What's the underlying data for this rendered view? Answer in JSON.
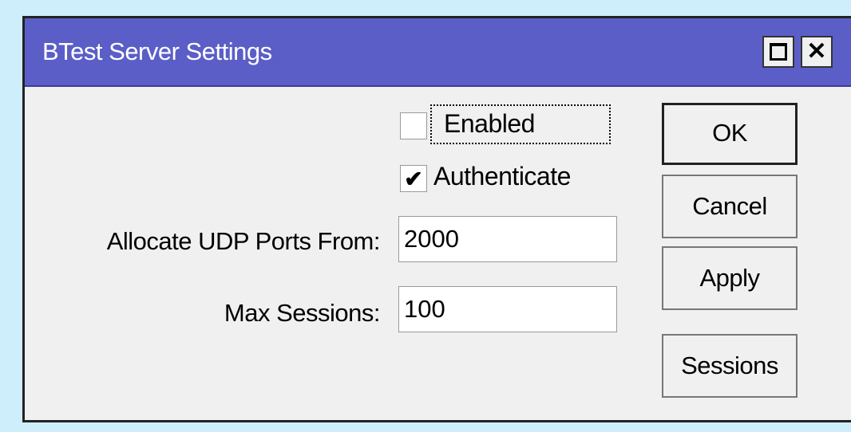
{
  "window": {
    "title": "BTest Server Settings",
    "maximize_icon": "maximize-icon",
    "close_icon": "close-icon",
    "close_glyph": "✕",
    "titlebar_color": "#5b5ec7"
  },
  "form": {
    "enabled": {
      "label": "Enabled",
      "checked": false
    },
    "authenticate": {
      "label": "Authenticate",
      "checked": true,
      "mark": "✔"
    },
    "udp_ports": {
      "label": "Allocate UDP Ports From:",
      "value": "2000"
    },
    "max_sessions": {
      "label": "Max Sessions:",
      "value": "100"
    }
  },
  "buttons": {
    "ok": "OK",
    "cancel": "Cancel",
    "apply": "Apply",
    "sessions": "Sessions"
  }
}
